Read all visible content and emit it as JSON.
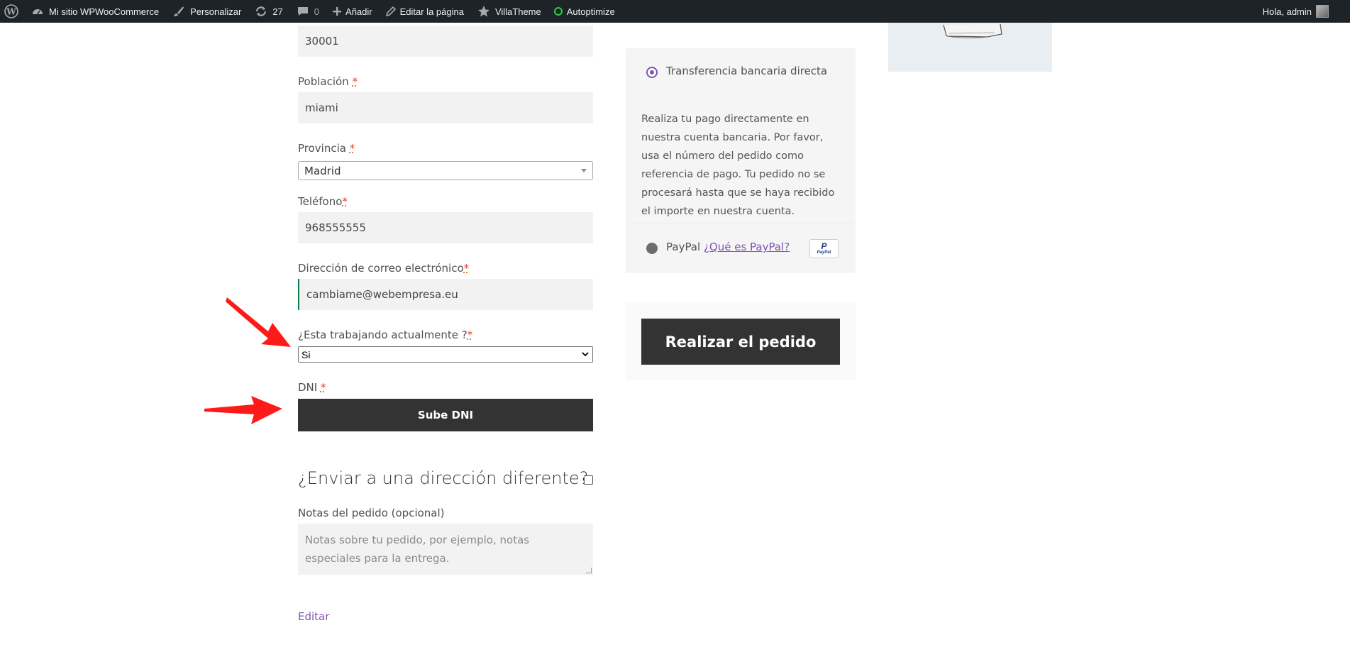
{
  "admin_bar": {
    "site_name": "Mi sitio WPWooCommerce",
    "customize": "Personalizar",
    "updates_count": "27",
    "comments_count": "0",
    "add_new": "Añadir",
    "edit_page": "Editar la página",
    "villatheme": "VillaTheme",
    "autoptimize": "Autoptimize",
    "greeting": "Hola, admin",
    "icons": [
      "wordpress-icon",
      "dashboard-icon",
      "brush-icon",
      "refresh-icon",
      "comment-icon",
      "plus-icon",
      "pencil-icon",
      "star-icon",
      "status-circle-icon"
    ]
  },
  "form": {
    "postcode_value": "30001",
    "city_label": "Población",
    "city_value": "miami",
    "province_label": "Provincia",
    "province_value": "Madrid",
    "phone_label": "Teléfono",
    "phone_value": "968555555",
    "email_label": "Dirección de correo electrónico",
    "email_value": "cambiame@webempresa.eu",
    "working_label": "¿Esta trabajando actualmente ?",
    "working_value": "Si",
    "dni_label": "DNI",
    "upload_button": "Sube DNI",
    "ship_diff_heading": "¿Enviar a una dirección diferente?",
    "notes_label": "Notas del pedido (opcional)",
    "notes_placeholder": "Notas sobre tu pedido, por ejemplo, notas especiales para la entrega.",
    "edit_link": "Editar",
    "required_mark": "*"
  },
  "payment": {
    "bacs_label": "Transferencia bancaria directa",
    "bacs_description": "Realiza tu pago directamente en nuestra cuenta bancaria. Por favor, usa el número del pedido como referencia de pago. Tu pedido no se procesará hasta que se haya recibido el importe en nuestra cuenta.",
    "paypal_label": "PayPal",
    "paypal_link": "¿Qué es PayPal?",
    "paypal_logo_text": "PayPal",
    "place_order": "Realizar el pedido",
    "accent_color": "#7f54b3"
  },
  "annotations": {
    "arrow_color": "#ff1a1a"
  }
}
